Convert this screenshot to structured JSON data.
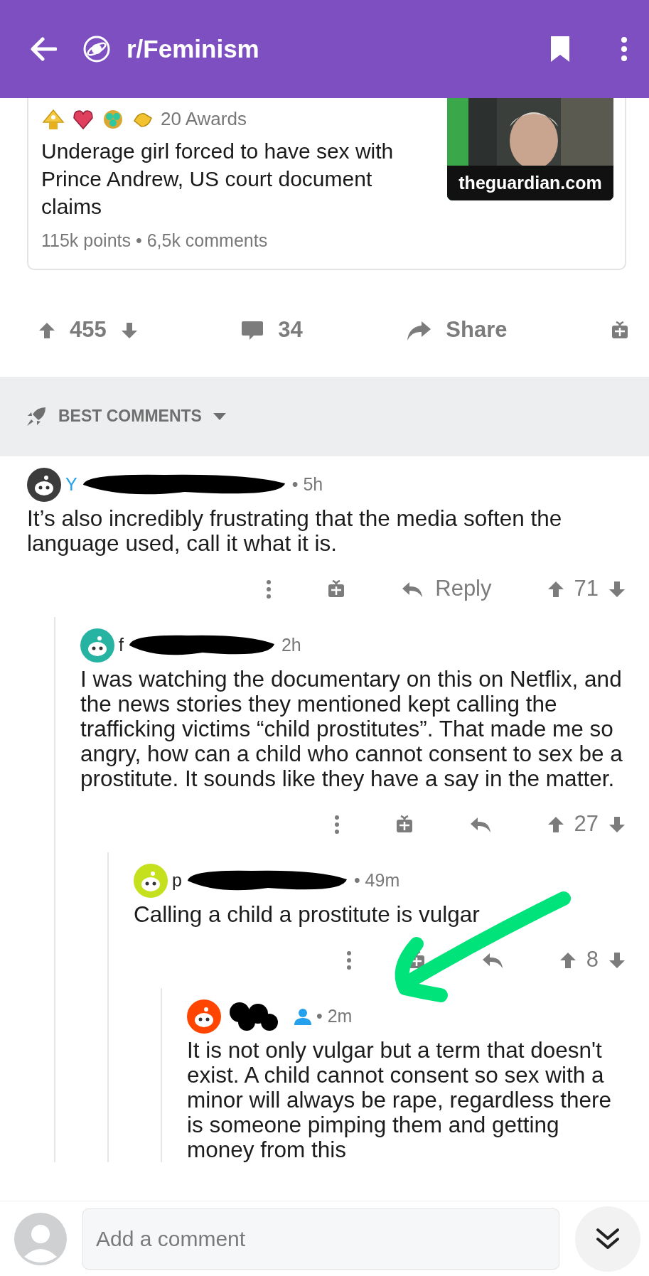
{
  "header": {
    "subreddit": "r/Feminism"
  },
  "post": {
    "awards": "20 Awards",
    "title": "Underage girl forced to have sex with Prince Andrew, US court document claims",
    "meta": "115k points • 6,5k comments",
    "domain": "theguardian.com"
  },
  "actions": {
    "score": "455",
    "comments": "34",
    "share": "Share"
  },
  "sort": {
    "label": "BEST COMMENTS"
  },
  "comments": [
    {
      "username": "Y",
      "highlighted": true,
      "redacted": true,
      "time": "• 5h",
      "body": "It’s also incredibly frustrating that the media soften the language used, call it what it is.",
      "reply_label": "Reply",
      "score": "71",
      "children": [
        {
          "username": "f",
          "highlighted": false,
          "redacted": true,
          "time": "2h",
          "body": "I was watching the documentary on this on Netflix, and the news stories they mentioned kept calling the trafficking victims “child prostitutes”. That made me so angry, how can a child who cannot consent to sex be a prostitute. It sounds like they have a say in the matter.",
          "score": "27",
          "children": [
            {
              "username": "p",
              "highlighted": false,
              "redacted": true,
              "time": "• 49m",
              "body": "Calling a child a prostitute is vulgar",
              "score": "8",
              "children": [
                {
                  "redacted": true,
                  "badge": true,
                  "time": "• 2m",
                  "body": "It is not only vulgar but a term that doesn't exist. A child cannot consent so sex with a minor will always be rape, regardless there is someone pimping them and getting money from this"
                }
              ]
            }
          ]
        }
      ]
    }
  ],
  "annotation": {
    "kind": "arrow"
  },
  "composer": {
    "placeholder": "Add a comment"
  }
}
